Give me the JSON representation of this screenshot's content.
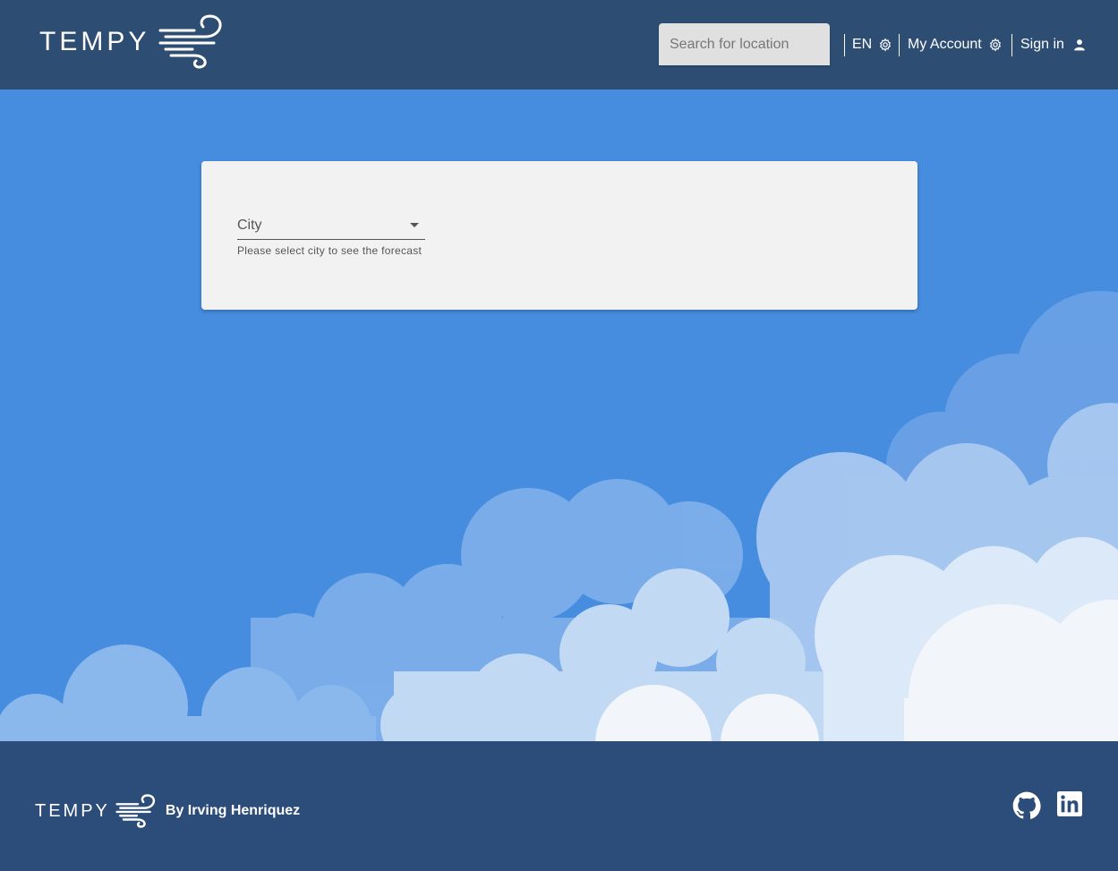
{
  "header": {
    "logo_text": "TEMPY",
    "search_placeholder": "Search for location",
    "language_label": "EN",
    "account_label": "My Account",
    "signin_label": "Sign in"
  },
  "card": {
    "select_label": "City",
    "helper_text": "Please select city to see the forecast"
  },
  "footer": {
    "logo_text": "TEMPY",
    "byline": "By Irving Henriquez"
  },
  "icons": {
    "language": "gear-icon",
    "account": "gear-icon",
    "signin": "person-icon",
    "github": "github-icon",
    "linkedin": "linkedin-icon"
  },
  "colors": {
    "header_bg": "#2e4d73",
    "sky": "#468de0",
    "card_bg": "#f2f2f2",
    "footer_bg": "#2c4c79"
  }
}
